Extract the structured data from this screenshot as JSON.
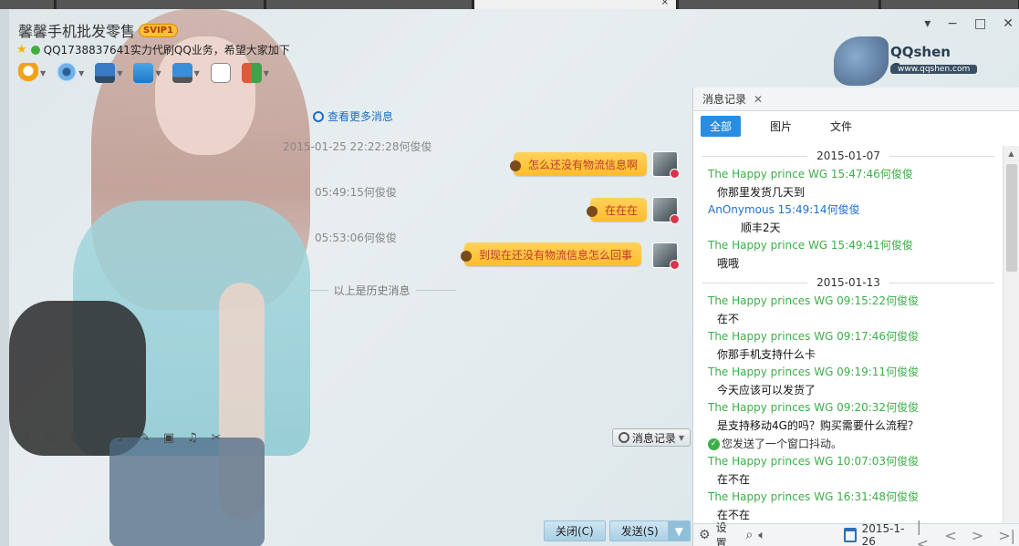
{
  "title": "馨馨手机批发零售",
  "vip": "SVIP1",
  "signature": "QQ1738837641实力代刷QQ业务，希望大家加下",
  "logo": {
    "brand": "QQshen Course",
    "url": "www.qqshen.com"
  },
  "chat": {
    "more_link": "查看更多消息",
    "messages": [
      {
        "time": "2015-01-25 22:22:28何俊俊",
        "text": "怎么还没有物流信息啊"
      },
      {
        "time": "05:49:15何俊俊",
        "text": "在在在"
      },
      {
        "time": "05:53:06何俊俊",
        "text": "到现在还没有物流信息怎么回事"
      }
    ],
    "history_divider": "以上是历史消息"
  },
  "edit_toolbar": {
    "history_button": "消息记录"
  },
  "actions": {
    "close": "关闭(C)",
    "send": "发送(S)"
  },
  "right_panel": {
    "tab_title": "消息记录",
    "filters": [
      "全部",
      "图片",
      "文件"
    ],
    "dates": [
      "2015-01-07",
      "2015-01-13"
    ],
    "entries": [
      {
        "h": "The Happy prince  WG 15:47:46何俊俊",
        "b": "你那里发货几天到"
      },
      {
        "h": "AnOnymous 15:49:14何俊俊",
        "b": "顺丰2天"
      },
      {
        "h": "The Happy prince  WG 15:49:41何俊俊",
        "b": "哦哦"
      },
      {
        "h": "The Happy princes  WG 09:15:22何俊俊",
        "b": "在不"
      },
      {
        "h": "The Happy princes  WG 09:17:46何俊俊",
        "b": "你那手机支持什么卡"
      },
      {
        "h": "The Happy princes  WG 09:19:11何俊俊",
        "b": "今天应该可以发货了"
      },
      {
        "h": "The Happy princes  WG 09:20:32何俊俊",
        "b": "是支持移动4G的吗？购买需要什么流程？"
      },
      {
        "shake": "您发送了一个窗口抖动。"
      },
      {
        "h": "The Happy princes  WG 10:07:03何俊俊",
        "b": "在不在"
      },
      {
        "h": "The Happy princes  WG 16:31:48何俊俊",
        "b": "在不在"
      }
    ],
    "bottom": {
      "settings": "设置",
      "date": "2015-1-26"
    }
  },
  "colors": {
    "accent_blue": "#2b8de0",
    "green_name": "#3eae49",
    "bubble": "#ffc93a"
  }
}
